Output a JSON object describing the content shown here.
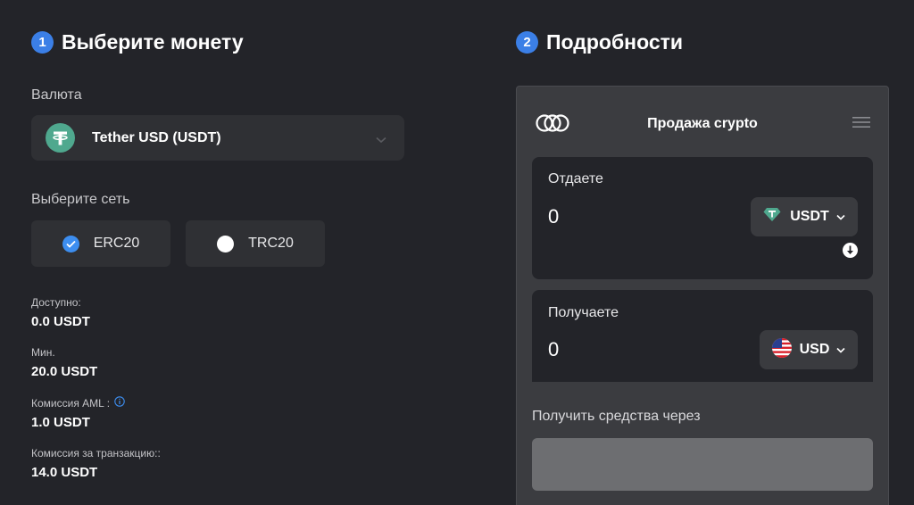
{
  "left": {
    "step_number": "1",
    "title": "Выберите монету",
    "currency_label": "Валюта",
    "currency": {
      "icon": "tether-icon",
      "name": "Tether USD (USDT)"
    },
    "network_label": "Выберите сеть",
    "networks": [
      {
        "label": "ERC20",
        "selected": true
      },
      {
        "label": "TRC20",
        "selected": false
      }
    ],
    "stats": [
      {
        "label": "Доступно:",
        "value": "0.0 USDT"
      },
      {
        "label": "Мин.",
        "value": "20.0 USDT"
      },
      {
        "label": "Комиссия AML :",
        "value": "1.0 USDT",
        "has_info": true
      },
      {
        "label": "Комиссия за транзакцию::",
        "value": "14.0 USDT"
      }
    ]
  },
  "right": {
    "step_number": "2",
    "title": "Подробности",
    "panel": {
      "title": "Продажа crypto",
      "give": {
        "label": "Отдаете",
        "amount": "0",
        "currency": "USDT"
      },
      "get": {
        "label": "Получаете",
        "amount": "0",
        "currency": "USD"
      },
      "receive_label": "Получить средства через"
    }
  },
  "colors": {
    "background": "#232429",
    "accent_blue": "#3b7fe6",
    "tether_green": "#4fa88e",
    "card_bg": "#2f3034",
    "panel_bg": "#3b3c40"
  }
}
